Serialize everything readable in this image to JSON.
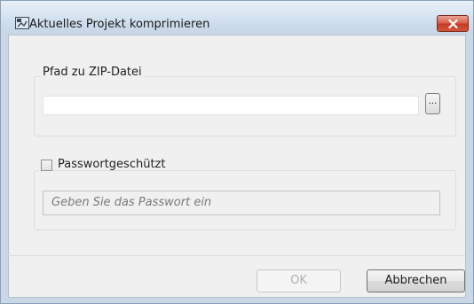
{
  "window": {
    "title": "Aktuelles Projekt komprimieren",
    "app_icon": "compress-project-icon",
    "close_icon": "close-icon"
  },
  "zip_group": {
    "label": "Pfad zu ZIP-Datei",
    "path_value": "",
    "browse_label": "..."
  },
  "password_group": {
    "checkbox_label": "Passwortgeschützt",
    "checked": false,
    "placeholder": "Geben Sie das Passwort ein",
    "enabled": false
  },
  "buttons": {
    "ok_label": "OK",
    "ok_enabled": false,
    "cancel_label": "Abbrechen"
  },
  "colors": {
    "close_button": "#c9462c",
    "window_frame": "#c9d7e6",
    "disabled_text": "#b0b0b0"
  }
}
